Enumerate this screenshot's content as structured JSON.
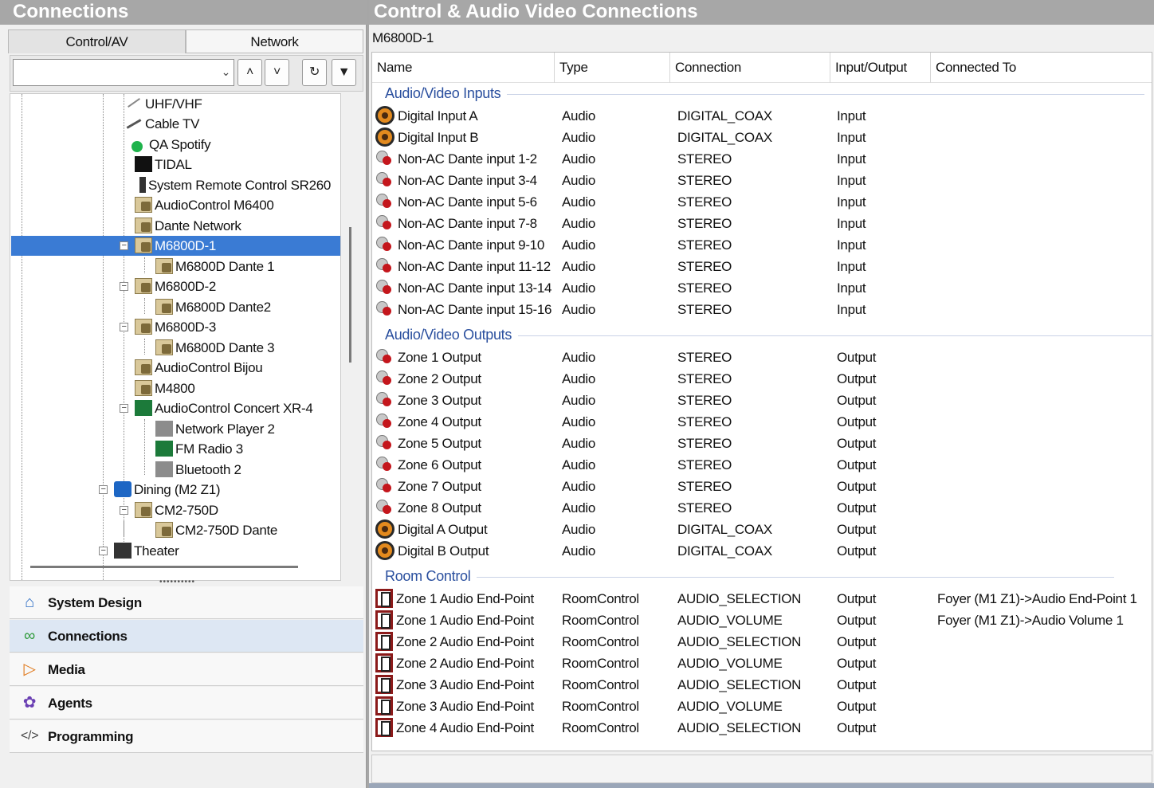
{
  "left_panel": {
    "title": "Connections",
    "tabs": [
      "Control/AV",
      "Network"
    ],
    "search_value": "",
    "tree": [
      {
        "label": "UHF/VHF",
        "icon": "antenna-icon"
      },
      {
        "label": "Cable TV",
        "icon": "cable-icon"
      },
      {
        "label": "QA Spotify",
        "icon": "spotify-icon"
      },
      {
        "label": "TIDAL",
        "icon": "tidal-icon"
      },
      {
        "label": "System Remote Control SR260",
        "icon": "remote-icon"
      },
      {
        "label": "AudioControl M6400",
        "icon": "device-icon"
      },
      {
        "label": "Dante Network",
        "icon": "device-icon"
      },
      {
        "label": "M6800D-1",
        "icon": "device-icon"
      },
      {
        "label": "M6800D Dante 1",
        "icon": "device-icon"
      },
      {
        "label": "M6800D-2",
        "icon": "device-icon"
      },
      {
        "label": "M6800D Dante2",
        "icon": "device-icon"
      },
      {
        "label": "M6800D-3",
        "icon": "device-icon"
      },
      {
        "label": "M6800D Dante 3",
        "icon": "device-icon"
      },
      {
        "label": "AudioControl Bijou",
        "icon": "device-icon"
      },
      {
        "label": "M4800",
        "icon": "device-icon"
      },
      {
        "label": "AudioControl Concert XR-4",
        "icon": "receiver-icon"
      },
      {
        "label": "Network Player 2",
        "icon": "network-player-icon"
      },
      {
        "label": "FM Radio 3",
        "icon": "radio-icon"
      },
      {
        "label": "Bluetooth 2",
        "icon": "bluetooth-player-icon"
      },
      {
        "label": "Dining (M2 Z1)",
        "icon": "zone-icon"
      },
      {
        "label": "CM2-750D",
        "icon": "device-icon"
      },
      {
        "label": "CM2-750D Dante",
        "icon": "device-icon"
      },
      {
        "label": "Theater",
        "icon": "theater-icon"
      }
    ],
    "nav": [
      {
        "label": "System Design",
        "icon": "house-icon"
      },
      {
        "label": "Connections",
        "icon": "connections-icon"
      },
      {
        "label": "Media",
        "icon": "play-icon"
      },
      {
        "label": "Agents",
        "icon": "agents-icon"
      },
      {
        "label": "Programming",
        "icon": "code-icon"
      }
    ]
  },
  "right_panel": {
    "title": "Control & Audio Video Connections",
    "device": "M6800D-1",
    "columns": [
      "Name",
      "Type",
      "Connection",
      "Input/Output",
      "Connected To"
    ],
    "groups": [
      {
        "label": "Audio/Video Inputs",
        "rows": [
          {
            "icon": "coax-icon",
            "name": "Digital Input A",
            "type": "Audio",
            "connection": "DIGITAL_COAX",
            "io": "Input",
            "to": ""
          },
          {
            "icon": "coax-icon",
            "name": "Digital Input B",
            "type": "Audio",
            "connection": "DIGITAL_COAX",
            "io": "Input",
            "to": ""
          },
          {
            "icon": "rca-icon",
            "name": "Non-AC Dante input 1-2",
            "type": "Audio",
            "connection": "STEREO",
            "io": "Input",
            "to": ""
          },
          {
            "icon": "rca-icon",
            "name": "Non-AC Dante input 3-4",
            "type": "Audio",
            "connection": "STEREO",
            "io": "Input",
            "to": ""
          },
          {
            "icon": "rca-icon",
            "name": "Non-AC Dante input 5-6",
            "type": "Audio",
            "connection": "STEREO",
            "io": "Input",
            "to": ""
          },
          {
            "icon": "rca-icon",
            "name": "Non-AC Dante input 7-8",
            "type": "Audio",
            "connection": "STEREO",
            "io": "Input",
            "to": ""
          },
          {
            "icon": "rca-icon",
            "name": "Non-AC Dante input 9-10",
            "type": "Audio",
            "connection": "STEREO",
            "io": "Input",
            "to": ""
          },
          {
            "icon": "rca-icon",
            "name": "Non-AC Dante input 11-12",
            "type": "Audio",
            "connection": "STEREO",
            "io": "Input",
            "to": ""
          },
          {
            "icon": "rca-icon",
            "name": "Non-AC Dante input 13-14",
            "type": "Audio",
            "connection": "STEREO",
            "io": "Input",
            "to": ""
          },
          {
            "icon": "rca-icon",
            "name": "Non-AC Dante input 15-16",
            "type": "Audio",
            "connection": "STEREO",
            "io": "Input",
            "to": ""
          }
        ]
      },
      {
        "label": "Audio/Video Outputs",
        "rows": [
          {
            "icon": "rca-icon",
            "name": "Zone 1 Output",
            "type": "Audio",
            "connection": "STEREO",
            "io": "Output",
            "to": ""
          },
          {
            "icon": "rca-icon",
            "name": "Zone 2 Output",
            "type": "Audio",
            "connection": "STEREO",
            "io": "Output",
            "to": ""
          },
          {
            "icon": "rca-icon",
            "name": "Zone 3 Output",
            "type": "Audio",
            "connection": "STEREO",
            "io": "Output",
            "to": ""
          },
          {
            "icon": "rca-icon",
            "name": "Zone 4 Output",
            "type": "Audio",
            "connection": "STEREO",
            "io": "Output",
            "to": ""
          },
          {
            "icon": "rca-icon",
            "name": "Zone 5 Output",
            "type": "Audio",
            "connection": "STEREO",
            "io": "Output",
            "to": ""
          },
          {
            "icon": "rca-icon",
            "name": "Zone 6 Output",
            "type": "Audio",
            "connection": "STEREO",
            "io": "Output",
            "to": ""
          },
          {
            "icon": "rca-icon",
            "name": "Zone 7 Output",
            "type": "Audio",
            "connection": "STEREO",
            "io": "Output",
            "to": ""
          },
          {
            "icon": "rca-icon",
            "name": "Zone 8 Output",
            "type": "Audio",
            "connection": "STEREO",
            "io": "Output",
            "to": ""
          },
          {
            "icon": "coax-icon",
            "name": "Digital A Output",
            "type": "Audio",
            "connection": "DIGITAL_COAX",
            "io": "Output",
            "to": ""
          },
          {
            "icon": "coax-icon",
            "name": "Digital B Output",
            "type": "Audio",
            "connection": "DIGITAL_COAX",
            "io": "Output",
            "to": ""
          }
        ]
      },
      {
        "label": "Room Control",
        "rows": [
          {
            "icon": "room-control-icon",
            "name": "Zone 1 Audio End-Point",
            "type": "RoomControl",
            "connection": "AUDIO_SELECTION",
            "io": "Output",
            "to": "Foyer (M1 Z1)->Audio End-Point 1"
          },
          {
            "icon": "room-control-icon",
            "name": "Zone 1 Audio End-Point",
            "type": "RoomControl",
            "connection": "AUDIO_VOLUME",
            "io": "Output",
            "to": "Foyer (M1 Z1)->Audio Volume 1"
          },
          {
            "icon": "room-control-icon",
            "name": "Zone 2 Audio End-Point",
            "type": "RoomControl",
            "connection": "AUDIO_SELECTION",
            "io": "Output",
            "to": ""
          },
          {
            "icon": "room-control-icon",
            "name": "Zone 2 Audio End-Point",
            "type": "RoomControl",
            "connection": "AUDIO_VOLUME",
            "io": "Output",
            "to": ""
          },
          {
            "icon": "room-control-icon",
            "name": "Zone 3 Audio End-Point",
            "type": "RoomControl",
            "connection": "AUDIO_SELECTION",
            "io": "Output",
            "to": ""
          },
          {
            "icon": "room-control-icon",
            "name": "Zone 3 Audio End-Point",
            "type": "RoomControl",
            "connection": "AUDIO_VOLUME",
            "io": "Output",
            "to": ""
          },
          {
            "icon": "room-control-icon",
            "name": "Zone 4 Audio End-Point",
            "type": "RoomControl",
            "connection": "AUDIO_SELECTION",
            "io": "Output",
            "to": ""
          }
        ]
      }
    ]
  },
  "colors": {
    "header_bg": "#a7a7a7",
    "selection": "#3a7bd4",
    "group_label": "#2a4f9e",
    "nav_active": "#dde7f3"
  }
}
